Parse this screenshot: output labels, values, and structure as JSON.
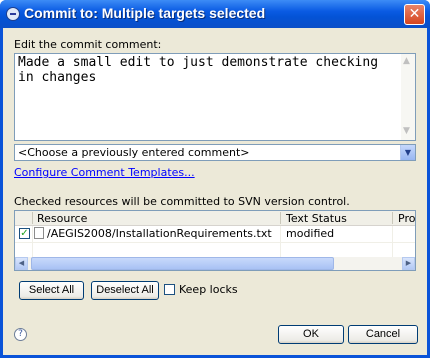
{
  "window": {
    "title": "Commit to: Multiple targets selected",
    "close_glyph": "✕"
  },
  "comment": {
    "label": "Edit the commit comment:",
    "text": "Made a small edit to just demonstrate checking in changes"
  },
  "previous_comments": {
    "selected": "<Choose a previously entered comment>"
  },
  "configure_link": "Configure Comment Templates...",
  "resources": {
    "label": "Checked resources will be committed to SVN version control.",
    "columns": [
      "Resource",
      "Text Status",
      "Prop"
    ],
    "rows": [
      {
        "checked": true,
        "resource": "/AEGIS2008/InstallationRequirements.txt",
        "text_status": "modified"
      }
    ]
  },
  "buttons": {
    "select_all": "Select All",
    "deselect_all": "Deselect All",
    "keep_locks": "Keep locks",
    "ok": "OK",
    "cancel": "Cancel"
  },
  "icons": {
    "title": "eclipse-icon",
    "close": "close-icon",
    "help": "help-icon",
    "file": "file-icon",
    "check": "checkmark-icon"
  },
  "colors": {
    "titlebar": "#0a53d8",
    "dialog_bg": "#ece9d8",
    "link": "#0000ff",
    "border": "#7f9db9"
  }
}
